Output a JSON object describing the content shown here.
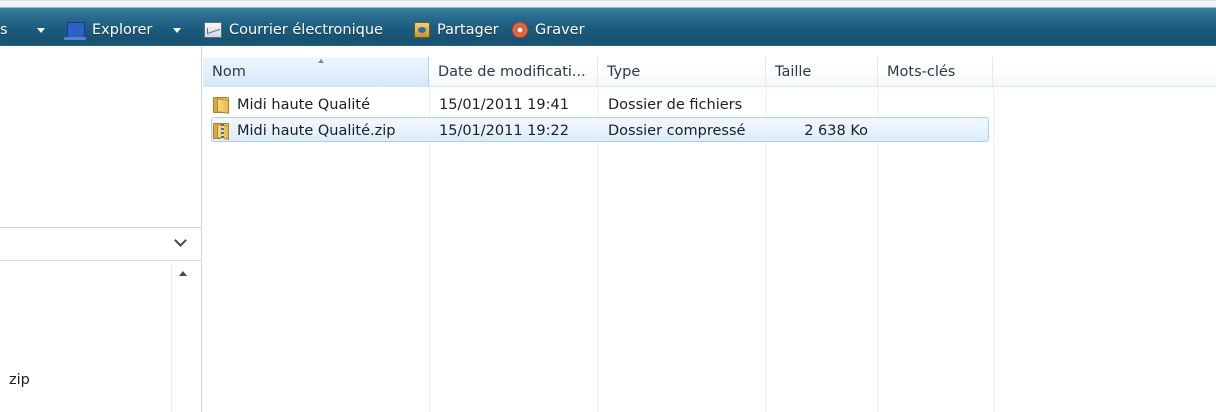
{
  "toolbar": {
    "truncated_left_label": "s",
    "explorer_label": "Explorer",
    "email_label": "Courrier électronique",
    "share_label": "Partager",
    "burn_label": "Graver"
  },
  "left_pane": {
    "truncated_item": "zip"
  },
  "columns": [
    {
      "key": "name",
      "label": "Nom"
    },
    {
      "key": "date",
      "label": "Date de modificati..."
    },
    {
      "key": "type",
      "label": "Type"
    },
    {
      "key": "size",
      "label": "Taille"
    },
    {
      "key": "keywords",
      "label": "Mots-clés"
    }
  ],
  "files": [
    {
      "name": "Midi haute Qualité",
      "date": "15/01/2011 19:41",
      "type": "Dossier de fichiers",
      "size": "",
      "icon": "folder-icon"
    },
    {
      "name": "Midi haute Qualité.zip",
      "date": "15/01/2011 19:22",
      "type": "Dossier compressé",
      "size": "2 638 Ko",
      "icon": "zip-folder-icon"
    }
  ]
}
